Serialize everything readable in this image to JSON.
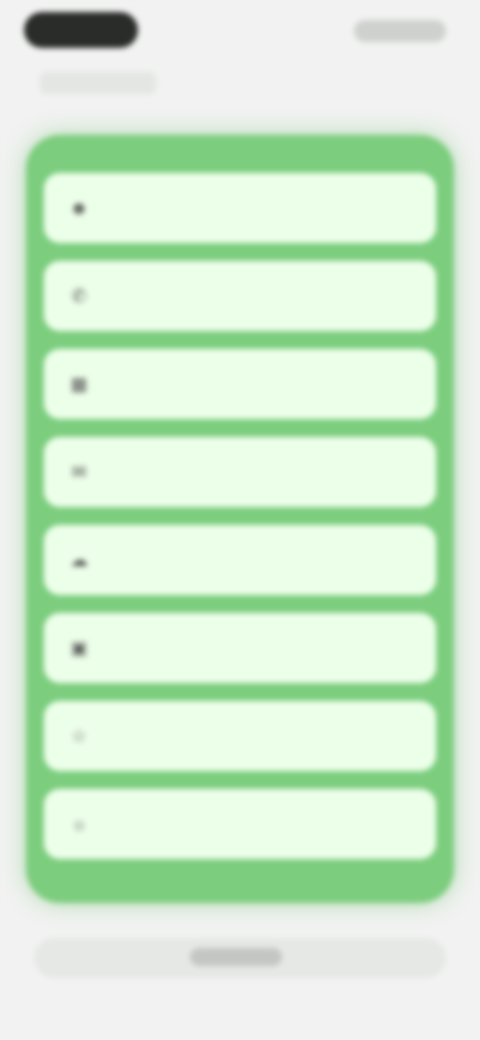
{
  "status_bar": {
    "left_label": "",
    "right_label": ""
  },
  "header": {
    "caption": ""
  },
  "list": {
    "items": [
      {
        "label": "",
        "icon": "person-icon"
      },
      {
        "label": "",
        "icon": "phone-icon"
      },
      {
        "label": "",
        "icon": "calendar-icon"
      },
      {
        "label": "",
        "icon": "message-icon"
      },
      {
        "label": "",
        "icon": "cloud-icon"
      },
      {
        "label": "",
        "icon": "grid-icon"
      },
      {
        "label": "",
        "icon": "star-icon"
      },
      {
        "label": "",
        "icon": "sun-icon"
      }
    ]
  },
  "bottom": {
    "label": ""
  },
  "colors": {
    "card": "#7ccd7e",
    "item": "#ecffe9",
    "background": "#f1f2f1"
  }
}
